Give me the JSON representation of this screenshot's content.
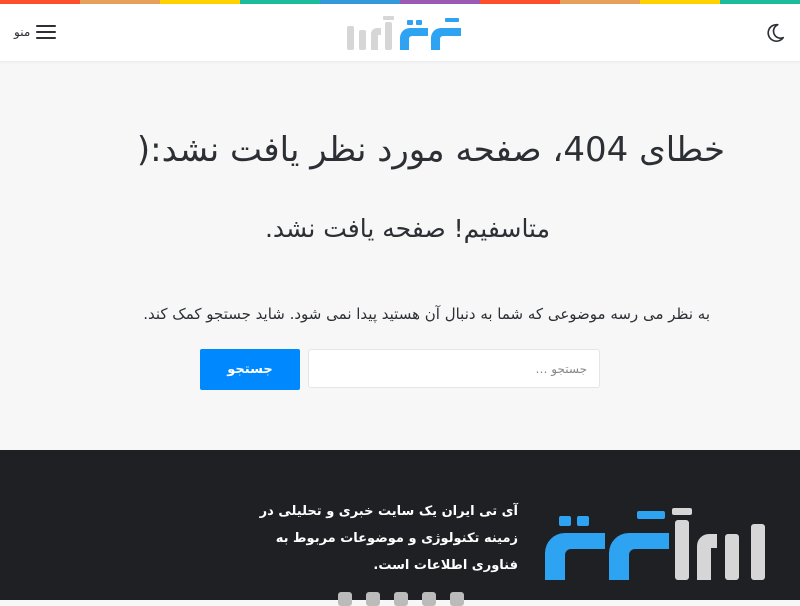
{
  "header": {
    "menu_label": "منو",
    "logo_alt": "آی تی ایران",
    "color_strip": [
      "#fe4f2d",
      "#e6a15b",
      "#ffd200",
      "#1bbc9b",
      "#3498db",
      "#9b59b6",
      "#fe4f2d",
      "#e6a15b",
      "#ffd200",
      "#1bbc9b"
    ]
  },
  "error": {
    "title": "خطای 404، صفحه مورد نظر یافت نشد:(",
    "subtitle": "متاسفیم! صفحه‌ یافت نشد.",
    "description": "به نظر می رسه‌ موضوعی که شما به دنبال آن هستید‌ پیدا نمی شود. شاید جستجو کمک کند."
  },
  "search": {
    "placeholder": "جستجو …",
    "button_label": "جستجو"
  },
  "footer": {
    "about_lines": [
      "آی تی ایران یک سایت خبری و تحلیلی در",
      "زمینه تکنولوژی و موضوعات مربوط به",
      "فناوری اطلاعات است."
    ]
  },
  "colors": {
    "accent": "#0088ff",
    "logo_gray": "#d6d6d6",
    "logo_blue": "#2ea3f2",
    "footer_bg": "#1f2024"
  },
  "icons": {
    "menu": "hamburger-icon",
    "theme": "moon-icon"
  }
}
